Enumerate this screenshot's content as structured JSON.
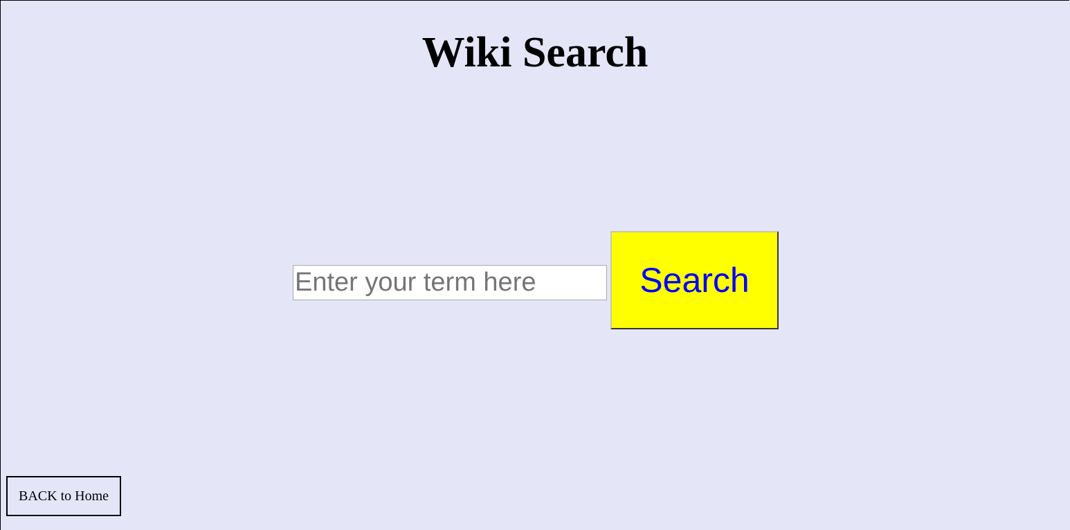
{
  "header": {
    "title": "Wiki Search"
  },
  "search": {
    "value": "",
    "placeholder": "Enter your term here",
    "button_label": "Search"
  },
  "footer": {
    "back_label": "BACK to Home"
  },
  "colors": {
    "background": "#e4e6f8",
    "button_background": "#ffff00",
    "button_text": "#0000ff"
  }
}
